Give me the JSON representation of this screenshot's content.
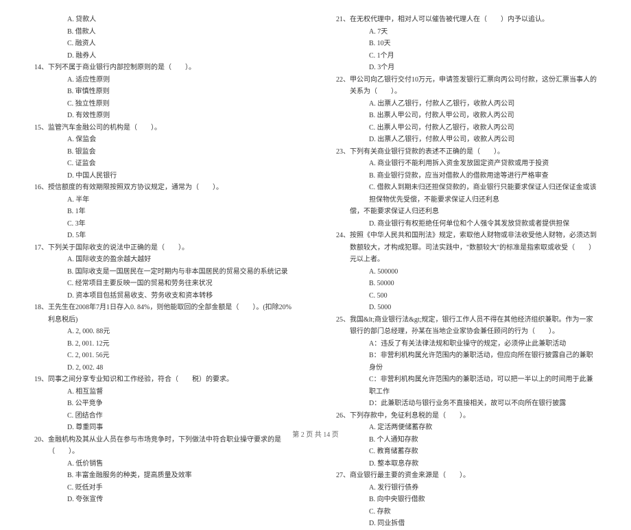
{
  "left_column": {
    "orphan_options": [
      "A. 贷款人",
      "B. 借款人",
      "C. 融资人",
      "D. 融券人"
    ],
    "questions": [
      {
        "num": "14",
        "text": "下列不属于商业银行内部控制原则的是（　　）。",
        "options": [
          "A. 适应性原则",
          "B. 审慎性原则",
          "C. 独立性原则",
          "D. 有效性原则"
        ]
      },
      {
        "num": "15",
        "text": "监管汽车金融公司的机构是（　　）。",
        "options": [
          "A. 保监会",
          "B. 银监会",
          "C. 证监会",
          "D. 中国人民银行"
        ]
      },
      {
        "num": "16",
        "text": "授信额度的有效期限按照双方协议规定，通常为（　　）。",
        "options": [
          "A. 半年",
          "B. 1年",
          "C. 3年",
          "D. 5年"
        ]
      },
      {
        "num": "17",
        "text": "下列关于国际收支的说法中正确的是（　　）。",
        "options": [
          "A. 国际收支的盈余越大越好",
          "B. 国际收支是一国居民在一定时期内与非本国居民的贸易交易的系统记录",
          "C. 经常项目主要反映一国的贸易和劳务往来状况",
          "D. 资本项目包括贸易收支、劳务收支和资本转移"
        ]
      },
      {
        "num": "18",
        "text": "王先生在2008年7月1日存入0. 84%，则他能取回的全部金额是（　　）。(扣除20%利息税后)",
        "options": [
          "A. 2, 000. 88元",
          "B. 2, 001. 12元",
          "C. 2, 001. 56元",
          "D. 2, 002. 48"
        ]
      },
      {
        "num": "19",
        "text": "同事之间分享专业知识和工作经验，符合（　　税）的要求。",
        "options": [
          "A. 相互监督",
          "B. 公平竞争",
          "C. 团结合作",
          "D. 尊重同事"
        ]
      },
      {
        "num": "20",
        "text": "金融机构及其从业人员在参与市场竞争时，下列做法中符合职业操守要求的是（　　）。",
        "options": [
          "A. 低价销售",
          "B. 丰富金融服务的种类，提高质量及效率",
          "C. 贬低对手",
          "D. 夸张宣传"
        ]
      }
    ]
  },
  "right_column": {
    "questions": [
      {
        "num": "21",
        "text": "在无权代理中，相对人可以催告被代理人在（　　）内予以追认。",
        "options": [
          "A. 7天",
          "B. 10天",
          "C. 1个月",
          "D. 3个月"
        ]
      },
      {
        "num": "22",
        "text": "甲公司向乙银行交付10万元，申请签发银行汇票向丙公司付款，这份汇票当事人的关系为（　　）。",
        "options": [
          "A. 出票人乙银行，付款人乙银行，收款人丙公司",
          "B. 出票人甲公司，付款人甲公司，收款人丙公司",
          "C. 出票人甲公司，付款人乙银行，收款人丙公司",
          "D. 出票人乙银行，付款人甲公司，收款人丙公司"
        ]
      },
      {
        "num": "23",
        "text": "下列有关商业银行贷款的表述不正确的是（　　）。",
        "options": [
          "A. 商业银行不能利用拆入资金发放固定资产贷款或用于投资",
          "B. 商业银行贷款，应当对借款人的借款用途等进行严格审查",
          "C. 借款人到期未归还担保贷款的，商业银行只能要求保证人归还保证金或该担保物优先受偿，不能要求保证人归还利息",
          "D. 商业银行有权拒绝任何单位和个人强令其发放贷款或者提供担保"
        ],
        "wrap_option": "偿，不能要求保证人归还利息"
      },
      {
        "num": "24",
        "text": "按照《中华人民共和国刑法》规定，索取他人财物或非法收受他人财物，必须达到数额较大，才构成犯罪。司法实践中，\"数额较大\"的标准是指索取或收受（　　）元以上者。",
        "options": [
          "A. 500000",
          "B. 50000",
          "C. 500",
          "D. 5000"
        ]
      },
      {
        "num": "25",
        "text": "我国&lt;商业银行法&gt;规定，银行工作人员不得在其他经济组织兼职。作为一家银行的部门总经理，孙某在当地企业家协会兼任顾问的行为（　　）。",
        "options": [
          "A：违反了有关法律法规和职业操守的规定，必须停止此兼职活动",
          "B：非营利机构属允许范围内的兼职活动，但应向所在银行披露自己的兼职身份",
          "C：非营利机构属允许范围内的兼职活动，可以把一半以上的时间用于此兼职工作",
          "D：此兼职活动与银行业务不直接相关，故可以不向所在银行披露"
        ]
      },
      {
        "num": "26",
        "text": "下列存款中，免征利息税的是（　　）。",
        "options": [
          "A. 定活两便储蓄存款",
          "B. 个人通知存款",
          "C. 教育储蓄存款",
          "D. 整本取息存款"
        ]
      },
      {
        "num": "27",
        "text": "商业银行最主要的资金来源是（　　）。",
        "options": [
          "A. 发行银行债券",
          "B. 向中央银行借款",
          "C. 存款",
          "D. 同业拆借"
        ]
      }
    ]
  },
  "footer": "第 2 页 共 14 页"
}
